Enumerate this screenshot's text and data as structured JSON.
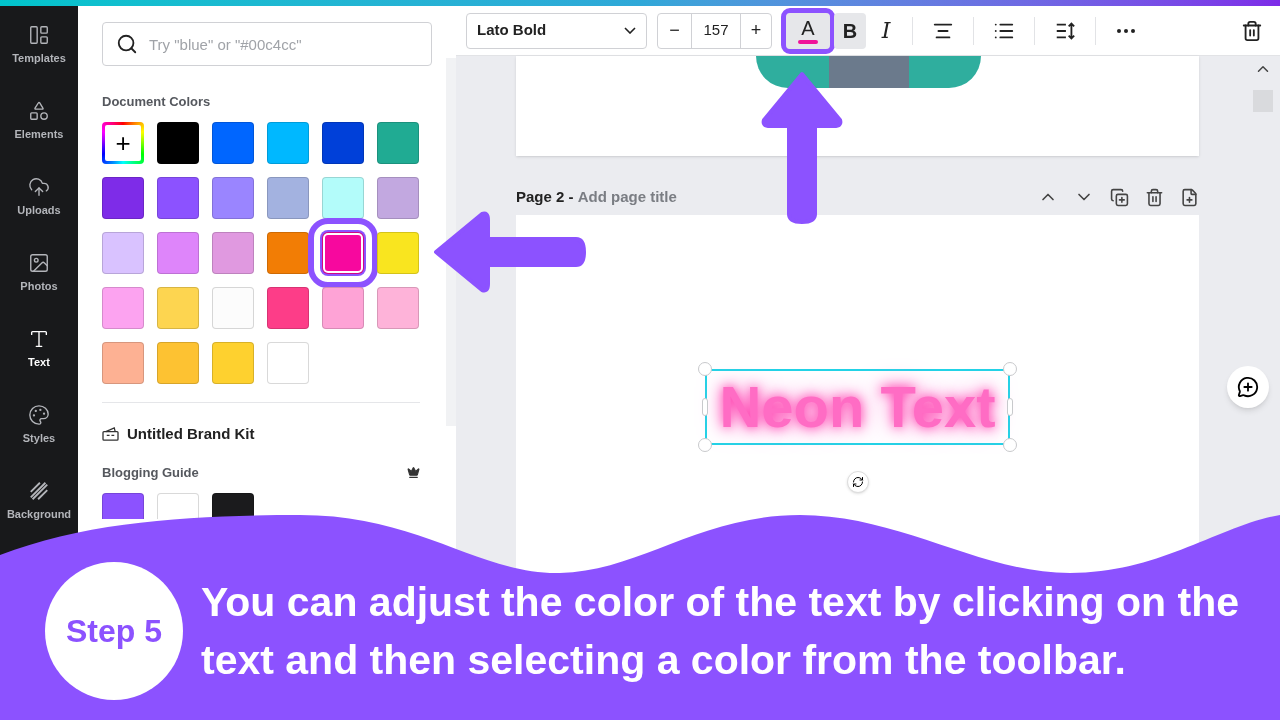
{
  "sidebar": {
    "items": [
      {
        "kind": "templates",
        "label": "Templates",
        "selected": false
      },
      {
        "kind": "elements",
        "label": "Elements",
        "selected": false
      },
      {
        "kind": "uploads",
        "label": "Uploads",
        "selected": false
      },
      {
        "kind": "photos",
        "label": "Photos",
        "selected": false
      },
      {
        "kind": "text",
        "label": "Text",
        "selected": true
      },
      {
        "kind": "styles",
        "label": "Styles",
        "selected": false
      },
      {
        "kind": "background",
        "label": "Background",
        "selected": false
      }
    ]
  },
  "color_panel": {
    "search": {
      "placeholder": "Try \"blue\" or \"#00c4cc\""
    },
    "document_colors": {
      "heading": "Document Colors",
      "swatches": [
        {
          "kind": "add",
          "label": "+",
          "selected": false
        },
        {
          "kind": "color",
          "color": "#000000",
          "selected": false
        },
        {
          "kind": "color",
          "color": "#0066ff",
          "selected": false
        },
        {
          "kind": "color",
          "color": "#00b8ff",
          "selected": false
        },
        {
          "kind": "color",
          "color": "#0040d9",
          "selected": false
        },
        {
          "kind": "color",
          "color": "#20ab93",
          "selected": false
        },
        {
          "kind": "color",
          "color": "#7e2ce8",
          "selected": false
        },
        {
          "kind": "color",
          "color": "#8c52ff",
          "selected": false
        },
        {
          "kind": "color",
          "color": "#9a85ff",
          "selected": false
        },
        {
          "kind": "color",
          "color": "#a3b2e0",
          "selected": false
        },
        {
          "kind": "color",
          "color": "#b3fcfa",
          "selected": false
        },
        {
          "kind": "color",
          "color": "#c2a8e0",
          "selected": false
        },
        {
          "kind": "color",
          "color": "#d9c2ff",
          "selected": false
        },
        {
          "kind": "color",
          "color": "#de85fa",
          "selected": false
        },
        {
          "kind": "color",
          "color": "#e099e0",
          "selected": false
        },
        {
          "kind": "color",
          "color": "#f27d05",
          "selected": false
        },
        {
          "kind": "color",
          "color": "#f7089e",
          "selected": true
        },
        {
          "kind": "color",
          "color": "#f9e51f",
          "selected": false
        },
        {
          "kind": "color",
          "color": "#fca3f0",
          "selected": false
        },
        {
          "kind": "color",
          "color": "#fdd550",
          "selected": false
        },
        {
          "kind": "color",
          "color": "#fcfcfc",
          "selected": false
        },
        {
          "kind": "color",
          "color": "#fd3d88",
          "selected": false
        },
        {
          "kind": "color",
          "color": "#fea3d6",
          "selected": false
        },
        {
          "kind": "color",
          "color": "#feb3d9",
          "selected": false
        },
        {
          "kind": "color",
          "color": "#fdb193",
          "selected": false
        },
        {
          "kind": "color",
          "color": "#fdc232",
          "selected": false
        },
        {
          "kind": "color",
          "color": "#fed12f",
          "selected": false
        },
        {
          "kind": "color",
          "color": "#ffffff",
          "selected": false
        }
      ]
    },
    "brand_kit": {
      "title": "Untitled Brand Kit",
      "palette": {
        "name": "Blogging Guide",
        "colors": [
          {
            "color": "#8c52ff"
          },
          {
            "color": "#ffffff"
          },
          {
            "color": "#1b1b1d"
          }
        ]
      }
    }
  },
  "toolbar": {
    "font": "Lato Bold",
    "size": {
      "minus": "−",
      "value": "157",
      "plus": "+"
    },
    "tools": [
      {
        "kind": "text-color",
        "label": "A",
        "color": "#f0139a",
        "selected": true
      },
      {
        "kind": "bold",
        "label": "B",
        "selected": true
      },
      {
        "kind": "italic",
        "label": "I",
        "selected": false
      },
      {
        "kind": "align",
        "selected": false
      },
      {
        "kind": "list",
        "selected": false
      },
      {
        "kind": "spacing",
        "selected": false
      },
      {
        "kind": "more",
        "selected": false
      }
    ]
  },
  "page2": {
    "title": "Page 2 -",
    "placeholder": "Add page title",
    "text": "Neon Text"
  },
  "banner": {
    "step": "Step 5",
    "text": "You can adjust the color of the text by clicking on the text and then selecting a color from the toolbar."
  }
}
